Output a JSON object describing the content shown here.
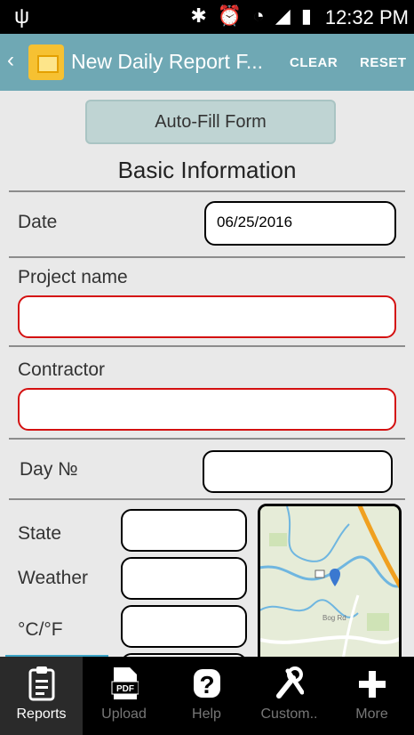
{
  "status_bar": {
    "time": "12:32 PM",
    "usb_icon": "usb-icon",
    "icons": [
      "bluetooth-icon",
      "alarm-icon",
      "wifi-icon",
      "signal-icon",
      "battery-icon"
    ]
  },
  "action_bar": {
    "back_icon": "‹",
    "title": "New Daily Report F...",
    "clear_label": "CLEAR",
    "reset_label": "RESET",
    "color": "#6fa8b4"
  },
  "form": {
    "autofill_label": "Auto-Fill Form",
    "section_title": "Basic Information",
    "date_label": "Date",
    "date_value": "06/25/2016",
    "project_label": "Project name",
    "project_value": "",
    "contractor_label": "Contractor",
    "contractor_value": "",
    "day_label": "Day №",
    "day_value": "",
    "state_label": "State",
    "state_value": "",
    "weather_label": "Weather",
    "weather_value": "",
    "temp_label": "°C/°F",
    "temp_value": "",
    "map_road_label": "Bog Rd"
  },
  "bottom_nav": {
    "items": [
      {
        "label": "Reports",
        "icon": "clipboard-icon",
        "active": true
      },
      {
        "label": "Upload",
        "icon": "pdf-icon",
        "active": false
      },
      {
        "label": "Help",
        "icon": "help-icon",
        "active": false
      },
      {
        "label": "Custom..",
        "icon": "tools-icon",
        "active": false
      },
      {
        "label": "More",
        "icon": "plus-icon",
        "active": false
      }
    ]
  }
}
